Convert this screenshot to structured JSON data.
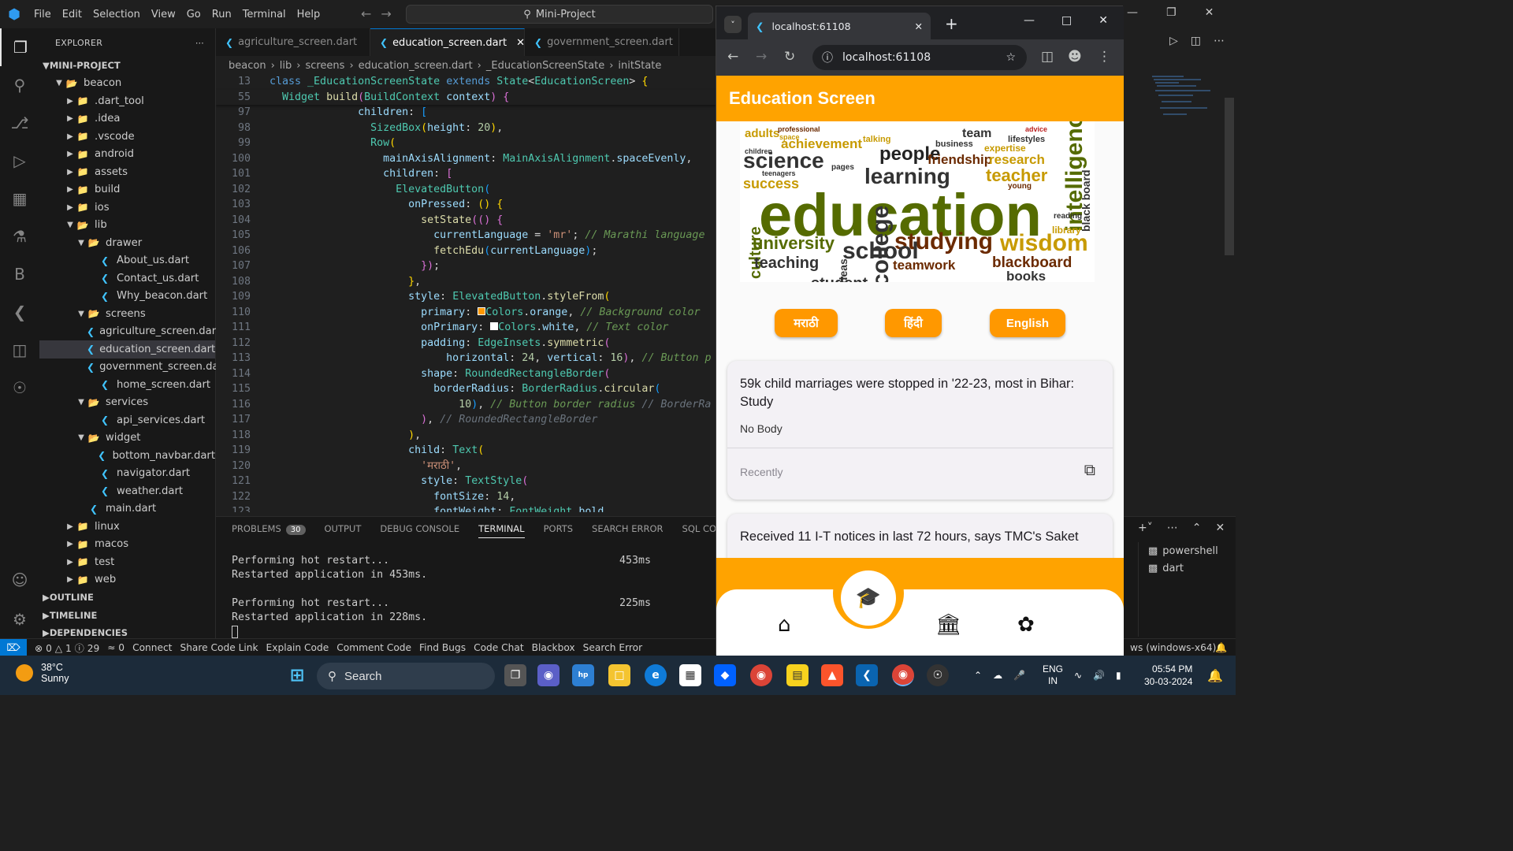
{
  "vscode": {
    "menu": [
      "File",
      "Edit",
      "Selection",
      "View",
      "Go",
      "Run",
      "Terminal",
      "Help"
    ],
    "command_center": "Mini-Project",
    "explorer": {
      "title": "EXPLORER",
      "project": "MINI-PROJECT",
      "tree": [
        {
          "label": "beacon",
          "depth": 1,
          "kind": "folder-open"
        },
        {
          "label": ".dart_tool",
          "depth": 2,
          "kind": "folder"
        },
        {
          "label": ".idea",
          "depth": 2,
          "kind": "folder"
        },
        {
          "label": ".vscode",
          "depth": 2,
          "kind": "folder"
        },
        {
          "label": "android",
          "depth": 2,
          "kind": "folder"
        },
        {
          "label": "assets",
          "depth": 2,
          "kind": "folder"
        },
        {
          "label": "build",
          "depth": 2,
          "kind": "folder"
        },
        {
          "label": "ios",
          "depth": 2,
          "kind": "folder"
        },
        {
          "label": "lib",
          "depth": 2,
          "kind": "folder-open"
        },
        {
          "label": "drawer",
          "depth": 3,
          "kind": "folder-open"
        },
        {
          "label": "About_us.dart",
          "depth": 4,
          "kind": "dart"
        },
        {
          "label": "Contact_us.dart",
          "depth": 4,
          "kind": "dart"
        },
        {
          "label": "Why_beacon.dart",
          "depth": 4,
          "kind": "dart"
        },
        {
          "label": "screens",
          "depth": 3,
          "kind": "folder-open"
        },
        {
          "label": "agriculture_screen.dart",
          "depth": 4,
          "kind": "dart"
        },
        {
          "label": "education_screen.dart",
          "depth": 4,
          "kind": "dart",
          "selected": true
        },
        {
          "label": "government_screen.dart",
          "depth": 4,
          "kind": "dart"
        },
        {
          "label": "home_screen.dart",
          "depth": 4,
          "kind": "dart"
        },
        {
          "label": "services",
          "depth": 3,
          "kind": "folder-open"
        },
        {
          "label": "api_services.dart",
          "depth": 4,
          "kind": "dart"
        },
        {
          "label": "widget",
          "depth": 3,
          "kind": "folder-open"
        },
        {
          "label": "bottom_navbar.dart",
          "depth": 4,
          "kind": "dart"
        },
        {
          "label": "navigator.dart",
          "depth": 4,
          "kind": "dart"
        },
        {
          "label": "weather.dart",
          "depth": 4,
          "kind": "dart"
        },
        {
          "label": "main.dart",
          "depth": 3,
          "kind": "dart"
        },
        {
          "label": "linux",
          "depth": 2,
          "kind": "folder"
        },
        {
          "label": "macos",
          "depth": 2,
          "kind": "folder"
        },
        {
          "label": "test",
          "depth": 2,
          "kind": "folder"
        },
        {
          "label": "web",
          "depth": 2,
          "kind": "folder"
        }
      ],
      "sections": [
        "OUTLINE",
        "TIMELINE",
        "DEPENDENCIES"
      ]
    },
    "tabs": [
      {
        "label": "agriculture_screen.dart",
        "active": false
      },
      {
        "label": "education_screen.dart",
        "active": true
      },
      {
        "label": "government_screen.dart",
        "active": false
      }
    ],
    "breadcrumbs": [
      "beacon",
      "lib",
      "screens",
      "education_screen.dart",
      "_EducationScreenState",
      "initState"
    ],
    "code_lines": [
      {
        "n": "13",
        "html": "<span class='kw'>class</span> <span class='ty'>_EducationScreenState</span> <span class='kw'>extends</span> <span class='ty'>State</span><span class='pl'>&lt;</span><span class='ty'>EducationScreen</span><span class='pl'>&gt;</span> <span class='br1'>{</span>",
        "sticky": true
      },
      {
        "n": "55",
        "html": "  <span class='ty'>Widget</span> <span class='fn'>build</span><span class='br2'>(</span><span class='ty'>BuildContext</span> <span class='pr'>context</span><span class='br2'>)</span> <span class='br2'>{</span>",
        "sticky": true
      },
      {
        "n": "97",
        "html": "              <span class='pr'>children</span><span class='pl'>:</span> <span class='br3'>[</span>"
      },
      {
        "n": "98",
        "html": "                <span class='ty'>SizedBox</span><span class='br1'>(</span><span class='pr'>height</span><span class='pl'>:</span> <span class='nm'>20</span><span class='br1'>)</span><span class='pl'>,</span>"
      },
      {
        "n": "99",
        "html": "                <span class='ty'>Row</span><span class='br1'>(</span>"
      },
      {
        "n": "100",
        "html": "                  <span class='pr'>mainAxisAlignment</span><span class='pl'>:</span> <span class='ty'>MainAxisAlignment</span><span class='pl'>.</span><span class='pr'>spaceEvenly</span><span class='pl'>,</span>"
      },
      {
        "n": "101",
        "html": "                  <span class='pr'>children</span><span class='pl'>:</span> <span class='br2'>[</span>"
      },
      {
        "n": "102",
        "html": "                    <span class='ty'>ElevatedButton</span><span class='br3'>(</span>"
      },
      {
        "n": "103",
        "html": "                      <span class='pr'>onPressed</span><span class='pl'>:</span> <span class='br1'>()</span> <span class='br1'>{</span>"
      },
      {
        "n": "104",
        "html": "                        <span class='fn'>setState</span><span class='br2'>(()</span> <span class='br2'>{</span>"
      },
      {
        "n": "105",
        "html": "                          <span class='pr'>currentLanguage</span> <span class='pl'>=</span> <span class='st'>'mr'</span><span class='pl'>;</span> <span class='cm'>// Marathi language</span>"
      },
      {
        "n": "106",
        "html": "                          <span class='fn'>fetchEdu</span><span class='br3'>(</span><span class='pr'>currentLanguage</span><span class='br3'>)</span><span class='pl'>;</span>"
      },
      {
        "n": "107",
        "html": "                        <span class='br2'>})</span><span class='pl'>;</span>"
      },
      {
        "n": "108",
        "html": "                      <span class='br1'>}</span><span class='pl'>,</span>"
      },
      {
        "n": "109",
        "html": "                      <span class='pr'>style</span><span class='pl'>:</span> <span class='ty'>ElevatedButton</span><span class='pl'>.</span><span class='fn'>styleFrom</span><span class='br1'>(</span>"
      },
      {
        "n": "110",
        "html": "                        <span class='pr'>primary</span><span class='pl'>:</span> <span style='display:inline-block;width:10px;height:10px;background:#ff9800;border:1px solid #fff;'></span><span class='ty'>Colors</span><span class='pl'>.</span><span class='pr'>orange</span><span class='pl'>,</span> <span class='cm'>// Background color</span>"
      },
      {
        "n": "111",
        "html": "                        <span class='pr'>onPrimary</span><span class='pl'>:</span> <span style='display:inline-block;width:10px;height:10px;background:#fff;'></span><span class='ty'>Colors</span><span class='pl'>.</span><span class='pr'>white</span><span class='pl'>,</span> <span class='cm'>// Text color</span>"
      },
      {
        "n": "112",
        "html": "                        <span class='pr'>padding</span><span class='pl'>:</span> <span class='ty'>EdgeInsets</span><span class='pl'>.</span><span class='fn'>symmetric</span><span class='br2'>(</span>"
      },
      {
        "n": "113",
        "html": "                            <span class='pr'>horizontal</span><span class='pl'>:</span> <span class='nm'>24</span><span class='pl'>,</span> <span class='pr'>vertical</span><span class='pl'>:</span> <span class='nm'>16</span><span class='br2'>)</span><span class='pl'>,</span> <span class='cm'>// Button p</span>"
      },
      {
        "n": "114",
        "html": "                        <span class='pr'>shape</span><span class='pl'>:</span> <span class='ty'>RoundedRectangleBorder</span><span class='br2'>(</span>"
      },
      {
        "n": "115",
        "html": "                          <span class='pr'>borderRadius</span><span class='pl'>:</span> <span class='ty'>BorderRadius</span><span class='pl'>.</span><span class='fn'>circular</span><span class='br3'>(</span>"
      },
      {
        "n": "116",
        "html": "                              <span class='nm'>10</span><span class='br3'>)</span><span class='pl'>,</span> <span class='cm'>// Button border radius</span> <span class='ghost'>// BorderRa</span>"
      },
      {
        "n": "117",
        "html": "                        <span class='br2'>)</span><span class='pl'>,</span> <span class='ghost'>// RoundedRectangleBorder</span>"
      },
      {
        "n": "118",
        "html": "                      <span class='br1'>)</span><span class='pl'>,</span>"
      },
      {
        "n": "119",
        "html": "                      <span class='pr'>child</span><span class='pl'>:</span> <span class='ty'>Text</span><span class='br1'>(</span>"
      },
      {
        "n": "120",
        "html": "                        <span class='st'>'मराठी'</span><span class='pl'>,</span>"
      },
      {
        "n": "121",
        "html": "                        <span class='pr'>style</span><span class='pl'>:</span> <span class='ty'>TextStyle</span><span class='br2'>(</span>"
      },
      {
        "n": "122",
        "html": "                          <span class='pr'>fontSize</span><span class='pl'>:</span> <span class='nm'>14</span><span class='pl'>,</span>"
      },
      {
        "n": "123",
        "html": "                          <span class='pr'>fontWeight</span><span class='pl'>:</span> <span class='ty'>FontWeight</span><span class='pl'>.</span><span class='pr'>bold</span><span class='pl'>,</span>"
      }
    ],
    "panel": {
      "tabs": [
        "PROBLEMS",
        "OUTPUT",
        "DEBUG CONSOLE",
        "TERMINAL",
        "PORTS",
        "SEARCH ERROR",
        "SQL CONSOLE"
      ],
      "problems_count": "30",
      "active_tab": "TERMINAL",
      "terminal": [
        {
          "text": "Performing hot restart...",
          "time": "453ms"
        },
        {
          "text": "Restarted application in 453ms.",
          "time": ""
        },
        {
          "text": "Performing hot restart...",
          "time": "225ms"
        },
        {
          "text": "Restarted application in 228ms.",
          "time": ""
        }
      ],
      "terminals": [
        "powershell",
        "dart"
      ]
    },
    "statusbar": {
      "errors": "0",
      "warnings": "1",
      "infos": "29",
      "ports": "0",
      "items": [
        "Connect",
        "Share Code Link",
        "Explain Code",
        "Comment Code",
        "Find Bugs",
        "Code Chat",
        "Blackbox",
        "Search Error"
      ],
      "right": "ws (windows-x64)"
    }
  },
  "browser": {
    "tab_title": "localhost:61108",
    "url": "localhost:61108",
    "app": {
      "appbar_title": "Education Screen",
      "wordcloud_words": [
        {
          "t": "adults",
          "c": "#c79a00"
        },
        {
          "t": "professional",
          "c": "#6b2a00"
        },
        {
          "t": "space",
          "c": "#c79a00"
        },
        {
          "t": "achievement",
          "c": "#c79a00"
        },
        {
          "t": "talking",
          "c": "#c79a00"
        },
        {
          "t": "team",
          "c": "#333"
        },
        {
          "t": "business",
          "c": "#333"
        },
        {
          "t": "lifestyles",
          "c": "#333"
        },
        {
          "t": "advice",
          "c": "#b22"
        },
        {
          "t": "expertise",
          "c": "#c79a00"
        },
        {
          "t": "children",
          "c": "#333"
        },
        {
          "t": "science",
          "c": "#333"
        },
        {
          "t": "people",
          "c": "#222"
        },
        {
          "t": "friendship",
          "c": "#6b2a00"
        },
        {
          "t": "research",
          "c": "#c79a00"
        },
        {
          "t": "intelligence",
          "c": "#556b00"
        },
        {
          "t": "pages",
          "c": "#333"
        },
        {
          "t": "success",
          "c": "#c79a00"
        },
        {
          "t": "teenagers",
          "c": "#333"
        },
        {
          "t": "learning",
          "c": "#333"
        },
        {
          "t": "teacher",
          "c": "#c79a00"
        },
        {
          "t": "young",
          "c": "#6b2a00"
        },
        {
          "t": "education",
          "c": "#556b00"
        },
        {
          "t": "culture",
          "c": "#556b00"
        },
        {
          "t": "reading",
          "c": "#333"
        },
        {
          "t": "library",
          "c": "#c79a00"
        },
        {
          "t": "black board",
          "c": "#333"
        },
        {
          "t": "university",
          "c": "#556b00"
        },
        {
          "t": "studying",
          "c": "#6b2a00"
        },
        {
          "t": "wisdom",
          "c": "#c79a00"
        },
        {
          "t": "teaching",
          "c": "#333"
        },
        {
          "t": "blackboard",
          "c": "#6b2a00"
        },
        {
          "t": "teamwork",
          "c": "#6b2a00"
        },
        {
          "t": "books",
          "c": "#333"
        },
        {
          "t": "ideas",
          "c": "#333"
        },
        {
          "t": "college",
          "c": "#333"
        },
        {
          "t": "school",
          "c": "#333"
        },
        {
          "t": "student",
          "c": "#333"
        }
      ],
      "languages": [
        "मराठी",
        "हिंदी",
        "English"
      ],
      "news": [
        {
          "title": "59k child marriages were stopped in '22-23, most in Bihar: Study",
          "body": "No Body",
          "time": "Recently"
        },
        {
          "title": "Received 11 I-T notices in last 72 hours, says TMC's Saket",
          "body": "",
          "time": ""
        }
      ],
      "nav_icons": [
        "home-icon",
        "school-icon",
        "bank-icon",
        "leaf-icon"
      ]
    }
  },
  "taskbar": {
    "weather_temp": "38°C",
    "weather_desc": "Sunny",
    "search_label": "Search",
    "lang_line1": "ENG",
    "lang_line2": "IN",
    "time": "05:54 PM",
    "date": "30-03-2024"
  },
  "colors": {
    "accent": "#ffa300",
    "button_orange": "#ff9800",
    "vscode_blue": "#0078d4"
  }
}
